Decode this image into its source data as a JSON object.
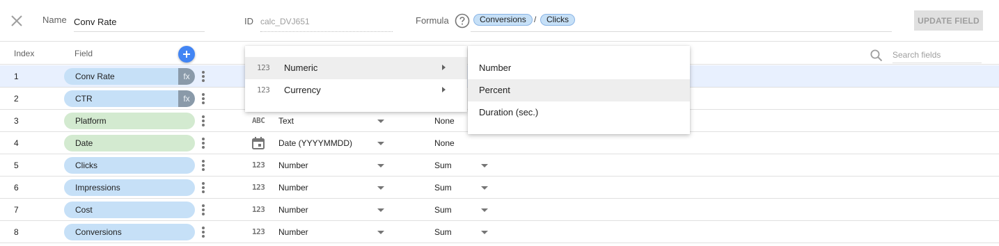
{
  "top": {
    "name_label": "Name",
    "name_value": "Conv Rate",
    "id_label": "ID",
    "id_value": "calc_DVJ651",
    "formula_label": "Formula",
    "formula_chip1": "Conversions",
    "formula_operator": "/",
    "formula_chip2": "Clicks",
    "update_button": "UPDATE FIELD"
  },
  "header": {
    "index": "Index",
    "field": "Field",
    "search_placeholder": "Search fields"
  },
  "rows": [
    {
      "index": "1",
      "field": "Conv Rate",
      "color": "blue",
      "calculated": true,
      "fx": "fx"
    },
    {
      "index": "2",
      "field": "CTR",
      "color": "blue",
      "calculated": true,
      "fx": "fx"
    },
    {
      "index": "3",
      "field": "Platform",
      "color": "green",
      "type_icon": "ABC",
      "type": "Text",
      "aggregation": "None"
    },
    {
      "index": "4",
      "field": "Date",
      "color": "green",
      "type_icon": "calendar-icon",
      "type": "Date (YYYYMMDD)",
      "aggregation": "None"
    },
    {
      "index": "5",
      "field": "Clicks",
      "color": "blue",
      "type_icon": "123",
      "type": "Number",
      "aggregation": "Sum"
    },
    {
      "index": "6",
      "field": "Impressions",
      "color": "blue",
      "type_icon": "123",
      "type": "Number",
      "aggregation": "Sum"
    },
    {
      "index": "7",
      "field": "Cost",
      "color": "blue",
      "type_icon": "123",
      "type": "Number",
      "aggregation": "Sum"
    },
    {
      "index": "8",
      "field": "Conversions",
      "color": "blue",
      "type_icon": "123",
      "type": "Number",
      "aggregation": "Sum"
    }
  ],
  "type_menu": [
    {
      "icon": "123",
      "label": "Numeric",
      "highlighted": true
    },
    {
      "icon": "123",
      "label": "Currency",
      "highlighted": false
    }
  ],
  "subtype_menu": [
    {
      "label": "Number",
      "highlighted": false
    },
    {
      "label": "Percent",
      "highlighted": true
    },
    {
      "label": "Duration (sec.)",
      "highlighted": false
    }
  ],
  "colors": {
    "dimension": "#d3ead0",
    "metric": "#c6e0f7",
    "accent": "#4285f4",
    "selected_row": "#e8f0fe"
  }
}
